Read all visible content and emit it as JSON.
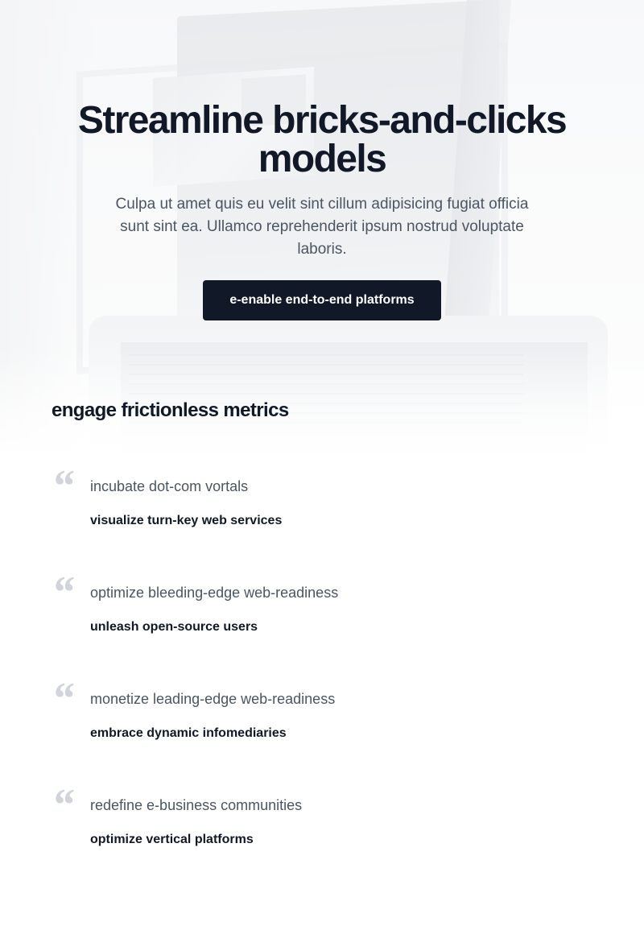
{
  "hero": {
    "title": "Streamline bricks-and-clicks models",
    "subtitle": "Culpa ut amet quis eu velit sint cillum adipisicing fugiat officia sunt sint ea. Ullamco reprehenderit ipsum nostrud voluptate laboris.",
    "button_label": "e-enable end-to-end platforms"
  },
  "testimonials": {
    "heading": "engage frictionless metrics",
    "quote_icon": "quote-icon",
    "items": [
      {
        "quote": "incubate dot-com vortals",
        "author": "visualize turn-key web services"
      },
      {
        "quote": "optimize bleeding-edge web-readiness",
        "author": "unleash open-source users"
      },
      {
        "quote": "monetize leading-edge web-readiness",
        "author": "embrace dynamic infomediaries"
      },
      {
        "quote": "redefine e-business communities",
        "author": "optimize vertical platforms"
      }
    ]
  },
  "colors": {
    "primary_dark": "#111827",
    "body_text": "#4b5563",
    "quote_mark": "#d1d5db",
    "background": "#ffffff"
  }
}
